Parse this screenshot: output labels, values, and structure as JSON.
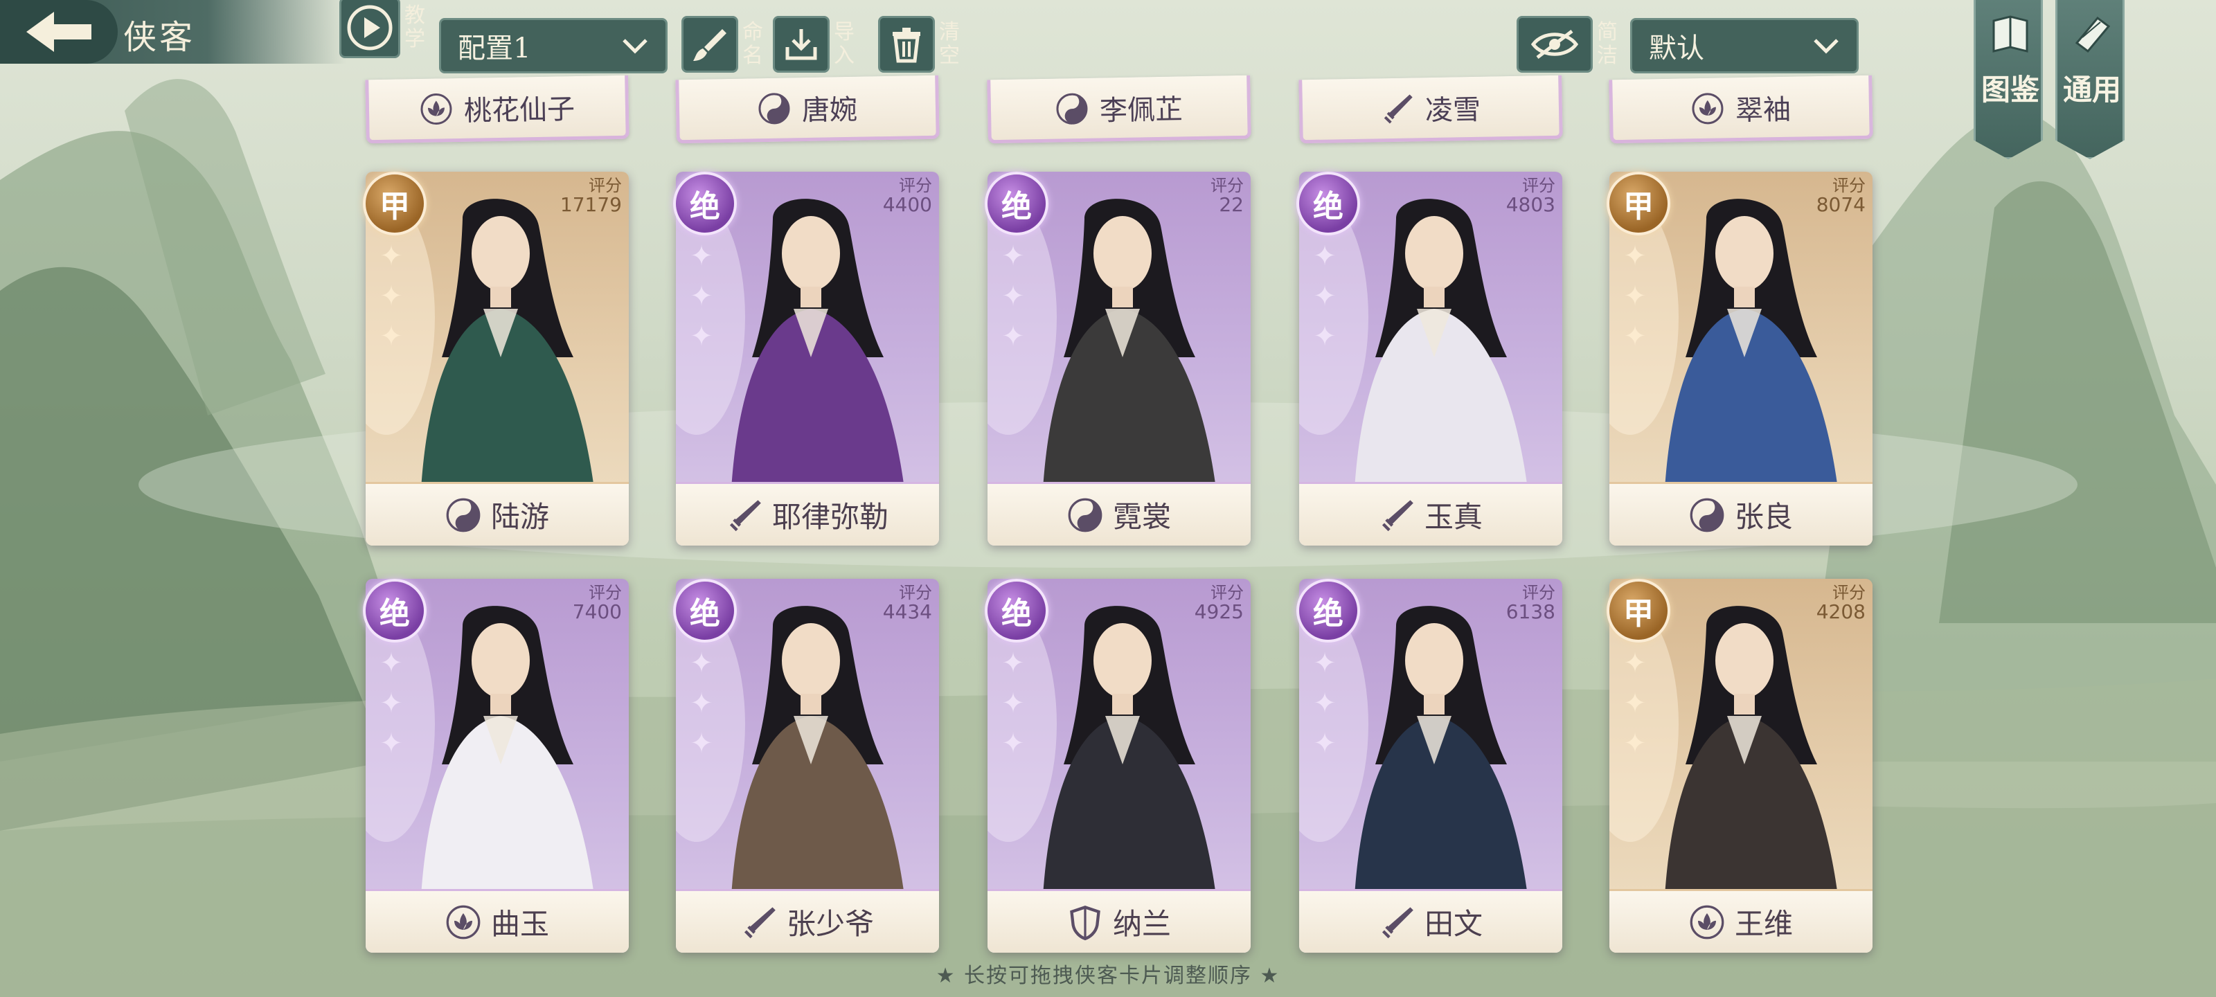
{
  "header": {
    "title": "侠客",
    "tutorial_label": "教学",
    "config_dropdown": "配置1",
    "rename_label": "命名",
    "import_label": "导入",
    "clear_label": "清空",
    "simplify_label": "简洁",
    "sort_dropdown": "默认",
    "codex_tab": "图鉴",
    "general_tab": "通用"
  },
  "top_row_partial": [
    {
      "name": "桃花仙子",
      "icon": "lotus-icon"
    },
    {
      "name": "唐婉",
      "icon": "yin-yang-icon"
    },
    {
      "name": "李佩芷",
      "icon": "yin-yang-icon"
    },
    {
      "name": "凌雪",
      "icon": "sword-icon"
    },
    {
      "name": "翠袖",
      "icon": "lotus-icon"
    }
  ],
  "score_label": "评分",
  "cards": [
    {
      "name": "陆游",
      "rarity": "甲",
      "tier": "gold",
      "score": "17179",
      "icon": "yin-yang-icon"
    },
    {
      "name": "耶律弥勒",
      "rarity": "绝",
      "tier": "purple",
      "score": "4400",
      "icon": "sword-icon"
    },
    {
      "name": "霓裳",
      "rarity": "绝",
      "tier": "purple",
      "score": "22",
      "icon": "yin-yang-icon"
    },
    {
      "name": "玉真",
      "rarity": "绝",
      "tier": "purple",
      "score": "4803",
      "icon": "sword-icon"
    },
    {
      "name": "张良",
      "rarity": "甲",
      "tier": "gold",
      "score": "8074",
      "icon": "yin-yang-icon"
    },
    {
      "name": "曲玉",
      "rarity": "绝",
      "tier": "purple",
      "score": "7400",
      "icon": "lotus-icon"
    },
    {
      "name": "张少爷",
      "rarity": "绝",
      "tier": "purple",
      "score": "4434",
      "icon": "sword-icon"
    },
    {
      "name": "纳兰",
      "rarity": "绝",
      "tier": "purple",
      "score": "4925",
      "icon": "shield-icon"
    },
    {
      "name": "田文",
      "rarity": "绝",
      "tier": "purple",
      "score": "6138",
      "icon": "sword-icon"
    },
    {
      "name": "王维",
      "rarity": "甲",
      "tier": "gold",
      "score": "4208",
      "icon": "lotus-icon"
    }
  ],
  "hint": "★ 长按可拖拽侠客卡片调整顺序 ★"
}
